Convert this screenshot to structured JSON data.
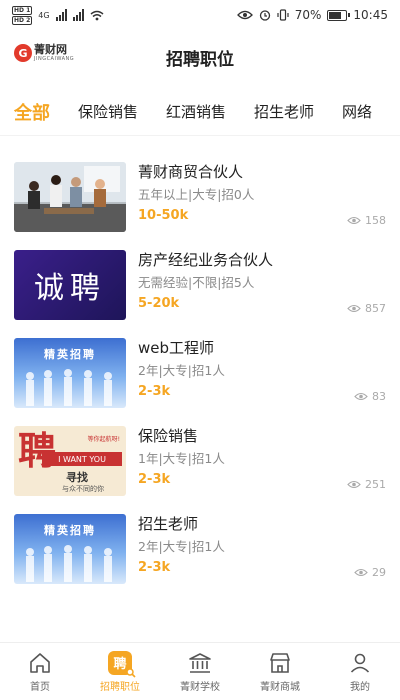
{
  "status_bar": {
    "hd1": "HD 1",
    "hd2": "HD 2",
    "network": "4G",
    "battery": "70%",
    "battery_level": 0.7,
    "time": "10:45"
  },
  "header": {
    "logo_cn": "菁财网",
    "logo_en": "JINGCAIWANG",
    "title": "招聘职位"
  },
  "tabs": [
    "全部",
    "保险销售",
    "红酒销售",
    "招生老师",
    "网络"
  ],
  "active_tab": 0,
  "jobs": [
    {
      "title": "菁财商贸合伙人",
      "meta": "五年以上|大专|招0人",
      "salary": "10-50k",
      "views": "158"
    },
    {
      "title": "房产经纪业务合伙人",
      "meta": "无需经验|不限|招5人",
      "salary": "5-20k",
      "views": "857",
      "thumb_text": "诚聘"
    },
    {
      "title": "web工程师",
      "meta": "2年|大专|招1人",
      "salary": "2-3k",
      "views": "83",
      "thumb_text": "精英招聘"
    },
    {
      "title": "保险销售",
      "meta": "1年|大专|招1人",
      "salary": "2-3k",
      "views": "251",
      "thumb_big": "聘",
      "thumb_band": "I WANT YOU",
      "thumb_seek": "寻找",
      "thumb_small": "与众不同的你",
      "thumb_tag": "等你起航呀!"
    },
    {
      "title": "招生老师",
      "meta": "2年|大专|招1人",
      "salary": "2-3k",
      "views": "29",
      "thumb_text": "精英招聘"
    }
  ],
  "bottom_nav": [
    {
      "label": "首页",
      "icon": "home-icon"
    },
    {
      "label": "招聘职位",
      "icon": "recruit-icon"
    },
    {
      "label": "菁财学校",
      "icon": "school-icon"
    },
    {
      "label": "菁财商城",
      "icon": "shop-icon"
    },
    {
      "label": "我的",
      "icon": "profile-icon"
    }
  ],
  "colors": {
    "accent": "#f5a623",
    "text": "#222222",
    "muted": "#8a8a8a"
  }
}
